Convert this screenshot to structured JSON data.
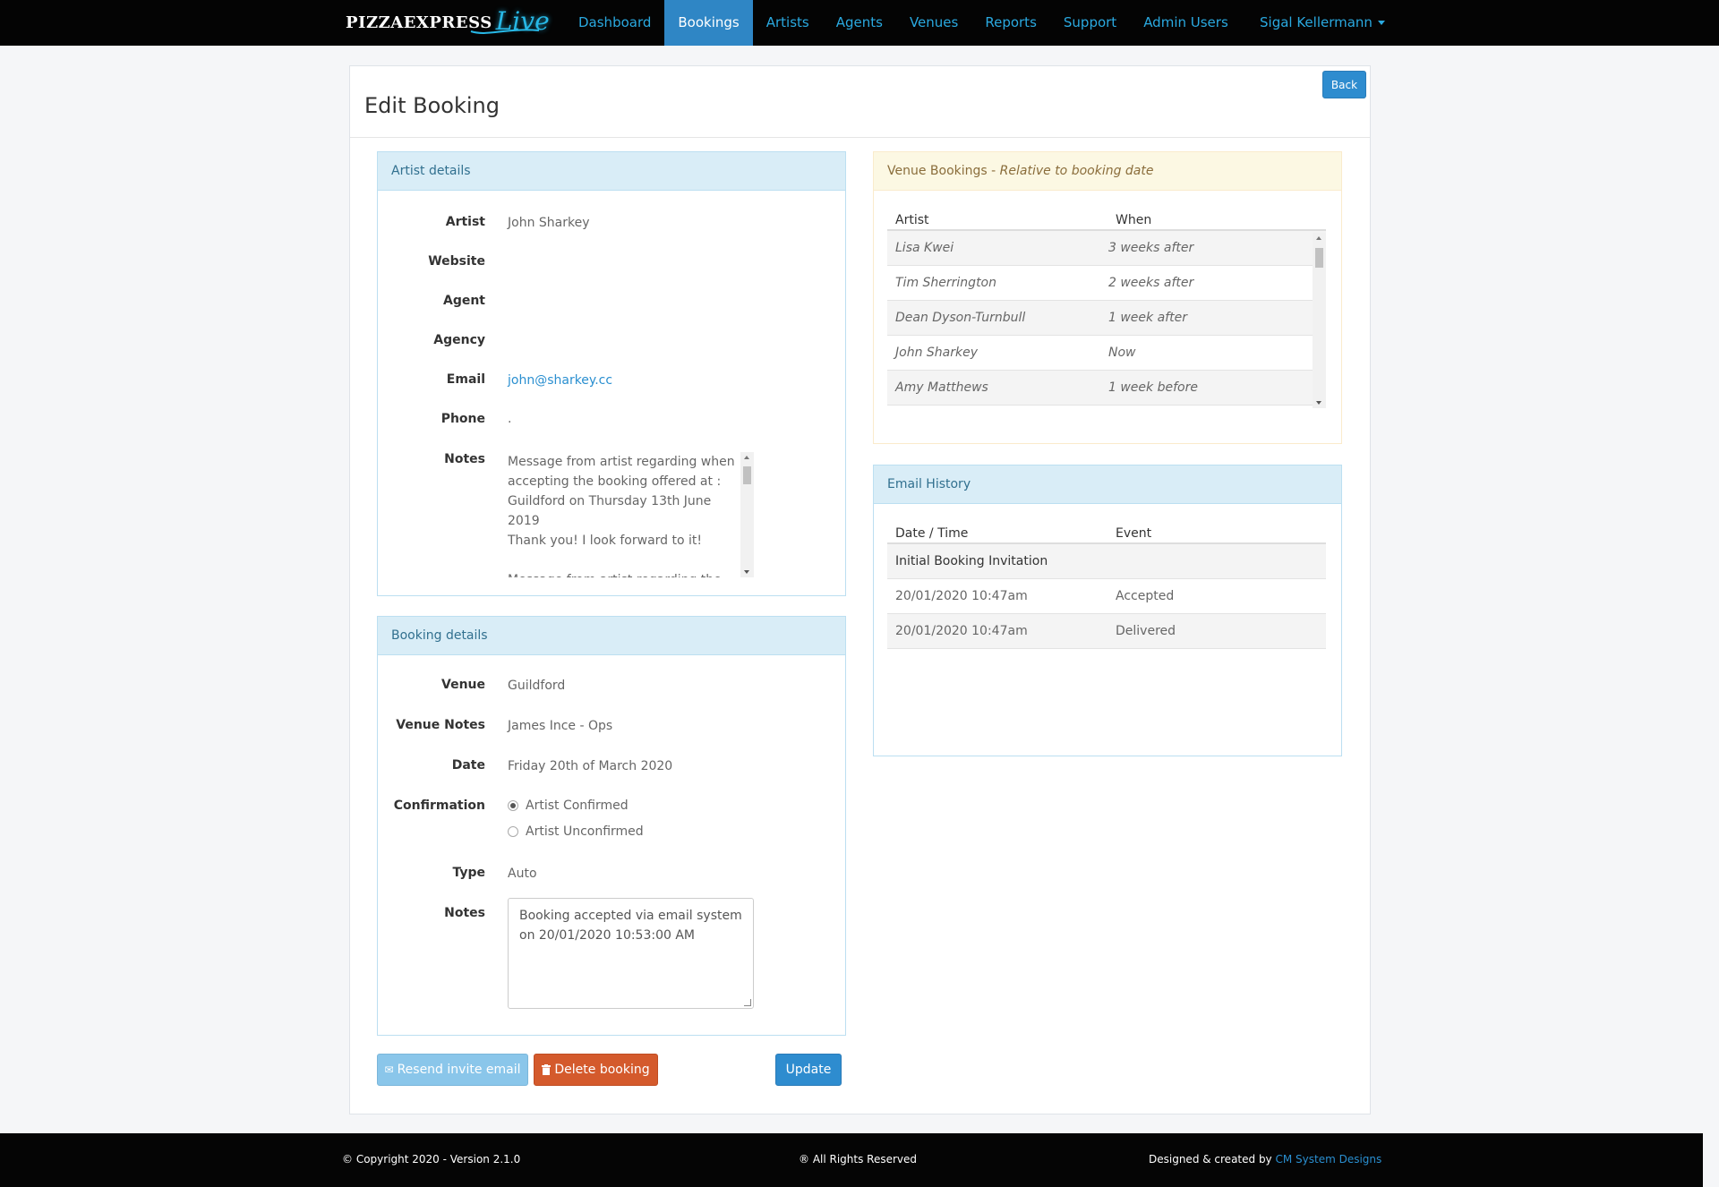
{
  "brand": {
    "name": "PIZZAEXPRESS",
    "live": "Live"
  },
  "nav": {
    "items": [
      "Dashboard",
      "Bookings",
      "Artists",
      "Agents",
      "Venues",
      "Reports",
      "Support",
      "Admin Users"
    ],
    "active": "Bookings",
    "user": "Sigal Kellermann"
  },
  "page": {
    "title": "Edit Booking",
    "back_label": "Back"
  },
  "artist_details": {
    "heading": "Artist details",
    "artist_label": "Artist",
    "artist": "John Sharkey",
    "website_label": "Website",
    "website": "",
    "agent_label": "Agent",
    "agent": "",
    "agency_label": "Agency",
    "agency": "",
    "email_label": "Email",
    "email": "john@sharkey.cc",
    "phone_label": "Phone",
    "phone": ".",
    "notes_label": "Notes",
    "notes": "Message from artist regarding when\naccepting the booking offered at :\nGuildford on Thursday 13th June 2019\nThank you! I look forward to it!\n\nMessage from artist regarding the"
  },
  "booking_details": {
    "heading": "Booking details",
    "venue_label": "Venue",
    "venue": "Guildford",
    "venue_notes_label": "Venue Notes",
    "venue_notes": "James Ince - Ops",
    "date_label": "Date",
    "date": "Friday 20th of March 2020",
    "confirmation_label": "Confirmation",
    "confirmation_options": [
      "Artist Confirmed",
      "Artist Unconfirmed"
    ],
    "confirmation_selected": "Artist Confirmed",
    "type_label": "Type",
    "type": "Auto",
    "notes_label": "Notes",
    "notes": "Booking accepted via email system on 20/01/2020 10:53:00 AM"
  },
  "venue_bookings": {
    "heading": "Venue Bookings - ",
    "heading_italic": "Relative to booking date",
    "columns": [
      "Artist",
      "When"
    ],
    "rows": [
      [
        "Lisa Kwei",
        "3 weeks after"
      ],
      [
        "Tim Sherrington",
        "2 weeks after"
      ],
      [
        "Dean Dyson-Turnbull",
        "1 week after"
      ],
      [
        "John Sharkey",
        "Now"
      ],
      [
        "Amy Matthews",
        "1 week before"
      ]
    ]
  },
  "email_history": {
    "heading": "Email History",
    "columns": [
      "Date / Time",
      "Event"
    ],
    "group": "Initial Booking Invitation",
    "rows": [
      [
        "20/01/2020 10:47am",
        "Accepted"
      ],
      [
        "20/01/2020 10:47am",
        "Delivered"
      ]
    ]
  },
  "actions": {
    "resend": "Resend invite email",
    "delete": "Delete booking",
    "update": "Update"
  },
  "footer": {
    "copyright": "© Copyright 2020 - Version 2.1.0",
    "rights": "® All Rights Reserved",
    "designed": "Designed & created by ",
    "designer": "CM System Designs"
  },
  "colors": {
    "navbar": "#040404",
    "nav_link": "#2aa9e0",
    "nav_active": "#2f86c5",
    "panel_info_heading": "#d9edf7",
    "panel_warning_heading": "#fcf8e3",
    "btn_primary": "#2e8ccf",
    "btn_danger": "#d45a2c",
    "btn_resend": "#8ac6ea"
  }
}
